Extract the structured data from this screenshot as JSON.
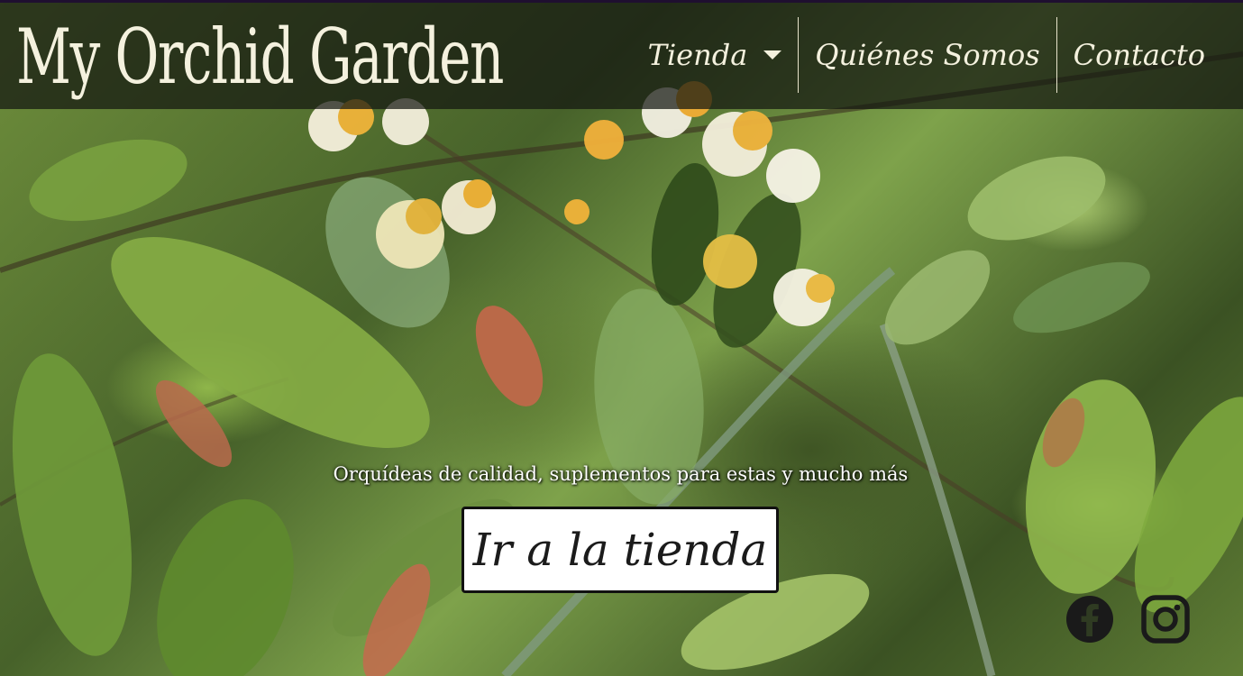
{
  "site": {
    "logo_text": "My Orchid Garden"
  },
  "nav": {
    "items": [
      {
        "label": "Tienda",
        "has_dropdown": true
      },
      {
        "label": "Quiénes Somos"
      },
      {
        "label": "Contacto"
      }
    ]
  },
  "hero": {
    "tagline": "Orquídeas de calidad, suplementos para estas y mucho más",
    "cta_label": "Ir a la tienda"
  },
  "social": {
    "icons": [
      "facebook-icon",
      "instagram-icon"
    ]
  },
  "colors": {
    "header_text": "#f4f1de",
    "cta_background": "#ffffff",
    "cta_border": "#111111",
    "icon_color": "#1a1a1a"
  }
}
